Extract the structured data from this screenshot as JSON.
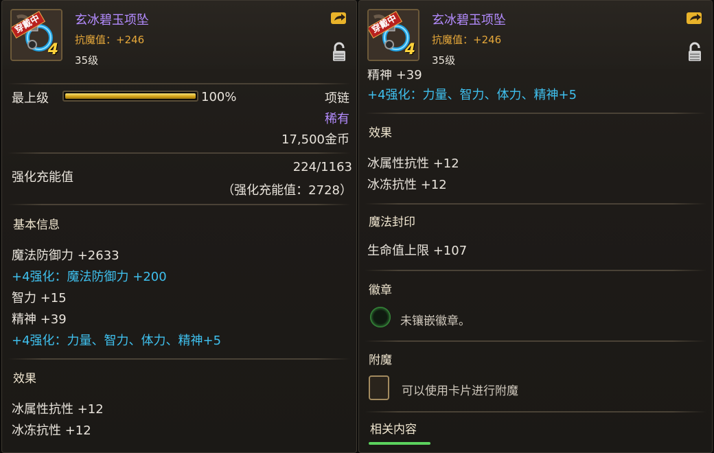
{
  "item": {
    "badge": "穿戴中",
    "enhance_level": "4",
    "name": "玄冰碧玉项坠",
    "magic_resist": "抗魔值：+246",
    "level": "35级"
  },
  "left": {
    "top_level_label": "最上级",
    "progress_percent": 100,
    "progress_text": "100%",
    "slot_type": "项链",
    "rarity": "稀有",
    "price": "17,500金币",
    "charge_label": "强化充能值",
    "charge_value": "224/1163",
    "charge_note": "（强化充能值：2728）",
    "basic_info_title": "基本信息",
    "stats": [
      "魔法防御力 +2633",
      "+4强化：魔法防御力 +200",
      "智力 +15",
      "精神 +39",
      "+4强化：力量、智力、体力、精神+5"
    ],
    "effect_title": "效果",
    "effects": [
      "冰属性抗性 +12",
      "冰冻抗性 +12"
    ]
  },
  "right": {
    "cut_line": "精神 +39",
    "enhance_line": "+4强化：力量、智力、体力、精神+5",
    "effect_title": "效果",
    "effects": [
      "冰属性抗性 +12",
      "冰冻抗性 +12"
    ],
    "seal_title": "魔法封印",
    "seal_value": "生命值上限 +107",
    "emblem_title": "徽章",
    "emblem_text": "未镶嵌徽章。",
    "enchant_title": "附魔",
    "enchant_text": "可以使用卡片进行附魔",
    "related_tab": "相关内容"
  }
}
